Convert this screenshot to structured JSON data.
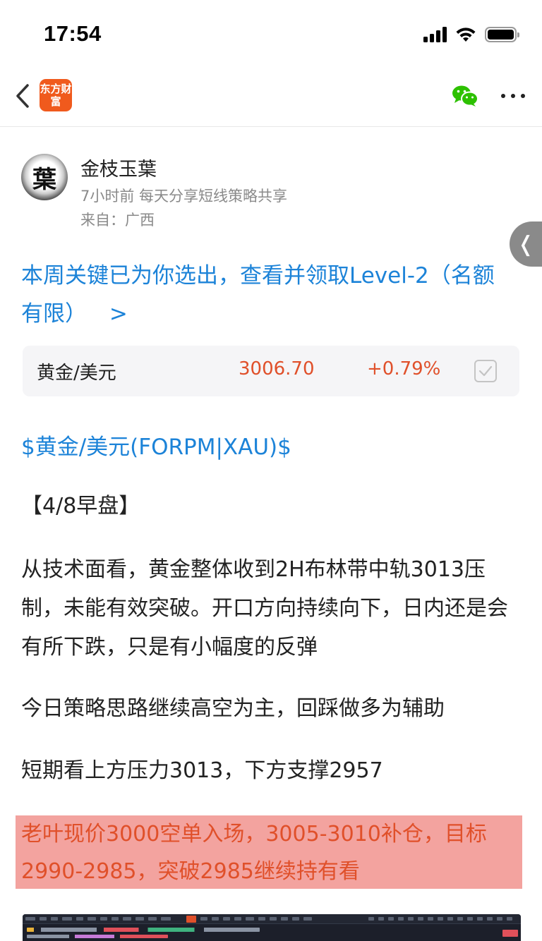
{
  "status_bar": {
    "time": "17:54"
  },
  "nav": {
    "app_logo_text": "东方财富"
  },
  "author": {
    "avatar_glyph": "葉",
    "name": "金枝玉葉",
    "meta": "7小时前 每天分享短线策略共享",
    "location": "来自：广西"
  },
  "promo": {
    "text": "本周关键已为你选出，查看并领取Level-2（名额有限）",
    "arrow": ">"
  },
  "stock_card": {
    "name": "黄金/美元",
    "price": "3006.70",
    "change": "+0.79%",
    "price_color": "#e0502a"
  },
  "article": {
    "ticker_link": "$黄金/美元(FORPM|XAU)$",
    "heading": "【4/8早盘】",
    "paragraph_1": "从技术面看，黄金整体收到2H布林带中轨3013压制，未能有效突破。开口方向持续向下，日内还是会有所下跌，只是有小幅度的反弹",
    "paragraph_2": "今日策略思路继续高空为主，回踩做多为辅助",
    "paragraph_3": "短期看上方压力3013，下方支撑2957",
    "highlight": "老叶现价3000空单入场，3005-3010补仓，目标2990-2985，突破2985继续持有看",
    "highlight_bg": "#f3a39f",
    "link_color": "#1c83d8"
  }
}
